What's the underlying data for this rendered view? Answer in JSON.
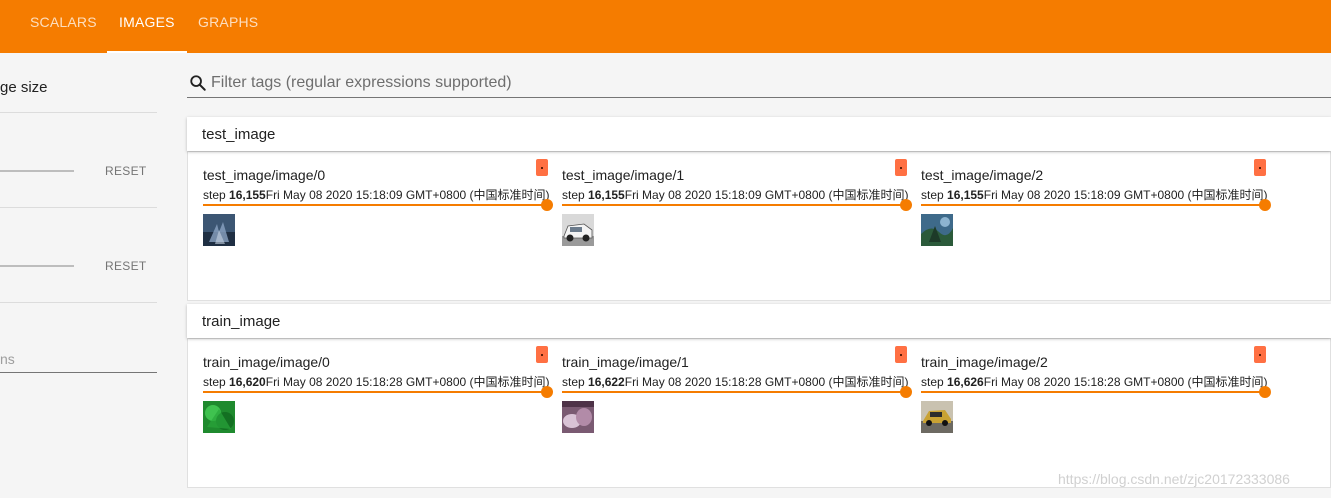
{
  "nav": {
    "tabs": [
      "SCALARS",
      "IMAGES",
      "GRAPHS"
    ],
    "active_tab": "IMAGES"
  },
  "sidebar": {
    "title_partial": "ge size",
    "reset_label_1": "RESET",
    "reset_label_2": "RESET",
    "input_partial": "ns"
  },
  "search": {
    "placeholder": "Filter tags (regular expressions supported)"
  },
  "sections": [
    {
      "title": "test_image",
      "cards": [
        {
          "tag": "test_image/image/0",
          "step_label": "step",
          "step": "16,155",
          "time": "Fri May 08 2020 15:18:09 GMT+0800 (中国标准时间)"
        },
        {
          "tag": "test_image/image/1",
          "step_label": "step",
          "step": "16,155",
          "time": "Fri May 08 2020 15:18:09 GMT+0800 (中国标准时间)"
        },
        {
          "tag": "test_image/image/2",
          "step_label": "step",
          "step": "16,155",
          "time": "Fri May 08 2020 15:18:09 GMT+0800 (中国标准时间)"
        }
      ]
    },
    {
      "title": "train_image",
      "cards": [
        {
          "tag": "train_image/image/0",
          "step_label": "step",
          "step": "16,620",
          "time": "Fri May 08 2020 15:18:28 GMT+0800 (中国标准时间)"
        },
        {
          "tag": "train_image/image/1",
          "step_label": "step",
          "step": "16,622",
          "time": "Fri May 08 2020 15:18:28 GMT+0800 (中国标准时间)"
        },
        {
          "tag": "train_image/image/2",
          "step_label": "step",
          "step": "16,626",
          "time": "Fri May 08 2020 15:18:28 GMT+0800 (中国标准时间)"
        }
      ]
    }
  ],
  "watermark": "https://blog.csdn.net/zjc20172333086",
  "colors": {
    "accent": "#f57c00",
    "badge": "#ff7043"
  },
  "icons": {
    "search": "search-icon",
    "badge": "image-badge-icon"
  }
}
